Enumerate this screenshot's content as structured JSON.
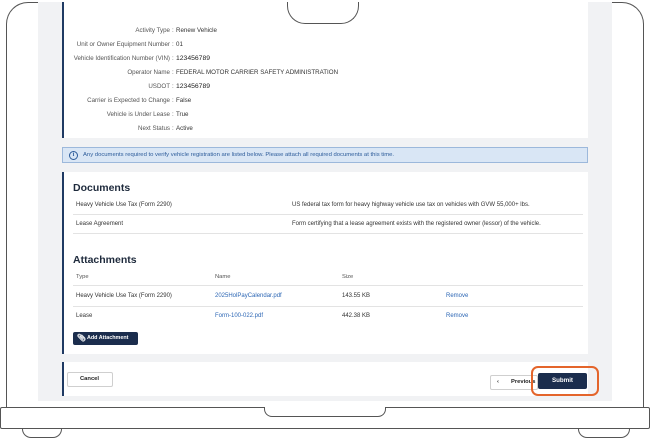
{
  "summary": {
    "rows": [
      {
        "label": "Activity Type",
        "value": "Renew Vehicle"
      },
      {
        "label": "Unit or Owner Equipment Number",
        "value": "01"
      },
      {
        "label": "Vehicle Identification Number (VIN)",
        "value": "123456789"
      },
      {
        "label": "Operator Name",
        "value": "FEDERAL MOTOR CARRIER SAFETY ADMINISTRATION"
      },
      {
        "label": "USDOT",
        "value": "123456789"
      },
      {
        "label": "Carrier is Expected to Change",
        "value": "False"
      },
      {
        "label": "Vehicle is Under Lease",
        "value": "True"
      },
      {
        "label": "Next Status",
        "value": "Active"
      }
    ],
    "separator": ":"
  },
  "notice": {
    "icon": "info-icon",
    "text": "Any documents required to verify vehicle registration are listed below. Please attach all required documents at this time."
  },
  "documents": {
    "title": "Documents",
    "items": [
      {
        "name": "Heavy Vehicle Use Tax (Form 2290)",
        "description": "US federal tax form for heavy highway vehicle use tax on vehicles with GVW 55,000+ lbs."
      },
      {
        "name": "Lease Agreement",
        "description": "Form certifying that a lease agreement exists with the registered owner (lessor) of the vehicle."
      }
    ]
  },
  "attachments": {
    "title": "Attachments",
    "columns": [
      "Type",
      "Name",
      "Size"
    ],
    "rows": [
      {
        "type": "Heavy Vehicle Use Tax (Form 2290)",
        "name": "2025HolPayCalendar.pdf",
        "size": "143.55 KB",
        "action": "Remove"
      },
      {
        "type": "Lease",
        "name": "Form-100-022.pdf",
        "size": "442.38 KB",
        "action": "Remove"
      }
    ],
    "add_label": "Add Attachment"
  },
  "footer": {
    "cancel_label": "Cancel",
    "previous_label": "Previous",
    "submit_label": "Submit"
  },
  "colors": {
    "primary": "#1b2d4d",
    "link": "#2d67b5",
    "highlight": "#e4652b",
    "notice_bg": "#d9e6f5"
  }
}
